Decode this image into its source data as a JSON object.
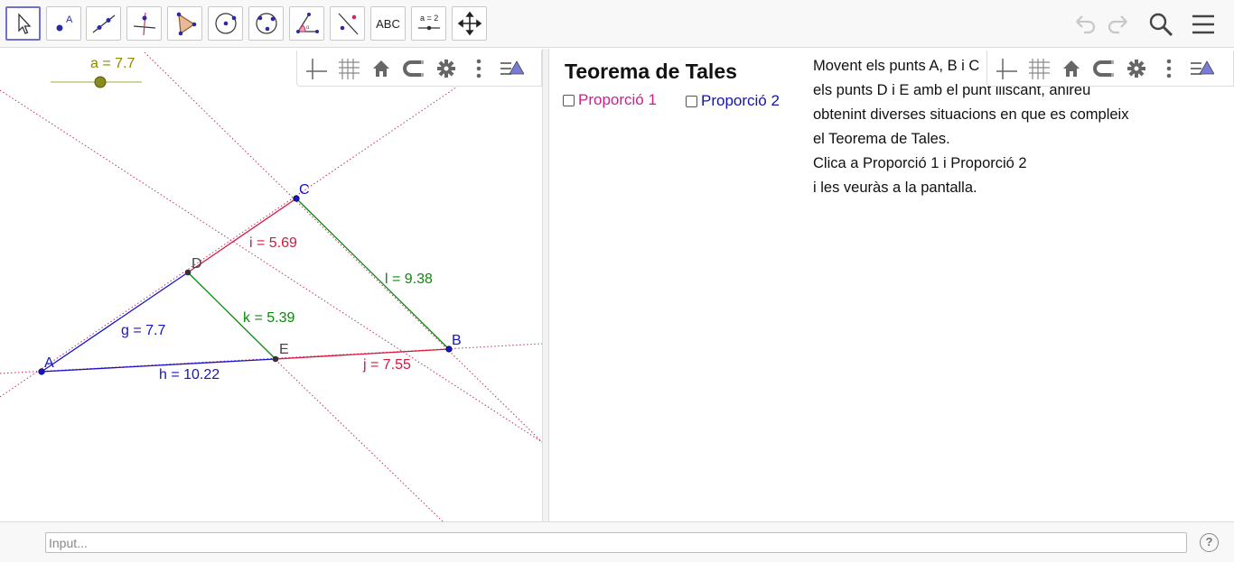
{
  "toolbar": {
    "tools": [
      {
        "name": "move-tool",
        "active": true
      },
      {
        "name": "point-tool"
      },
      {
        "name": "line-tool"
      },
      {
        "name": "perpendicular-line-tool"
      },
      {
        "name": "polygon-tool"
      },
      {
        "name": "circle-center-point-tool"
      },
      {
        "name": "circle-three-points-tool"
      },
      {
        "name": "angle-tool"
      },
      {
        "name": "reflect-about-line-tool"
      },
      {
        "name": "text-tool",
        "label": "ABC"
      },
      {
        "name": "slider-tool",
        "label": "a = 2"
      },
      {
        "name": "move-graphics-view-tool"
      }
    ],
    "right_icons": [
      "undo-icon",
      "redo-icon",
      "search-icon",
      "menu-icon"
    ]
  },
  "slider": {
    "label": "a = 7.7",
    "value": 7.7
  },
  "geometry": {
    "points": [
      {
        "name": "A",
        "color": "#1414cc"
      },
      {
        "name": "B",
        "color": "#1414cc"
      },
      {
        "name": "C",
        "color": "#1414cc"
      },
      {
        "name": "D",
        "color": "#333333"
      },
      {
        "name": "E",
        "color": "#333333"
      }
    ],
    "segments": [
      {
        "label": "g = 7.7",
        "color": "#1414cc"
      },
      {
        "label": "h = 10.22",
        "color": "#1414cc"
      },
      {
        "label": "i = 5.69",
        "color": "#d8163c"
      },
      {
        "label": "j = 7.55",
        "color": "#d8163c"
      },
      {
        "label": "k = 5.39",
        "color": "#0a8a0a"
      },
      {
        "label": "l = 9.38",
        "color": "#0a8a0a"
      }
    ],
    "auxiliary_line_color": "#c0306a"
  },
  "panel": {
    "title": "Teorema de Tales",
    "checkbox1": {
      "label": "Proporció 1",
      "color": "#cc1f8e",
      "checked": false
    },
    "checkbox2": {
      "label": "Proporció 2",
      "color": "#1414a8",
      "checked": false
    },
    "info_lines": [
      "Movent els punts A, B i C",
      "els punts D i E amb el punt lliscant, anireu",
      "obtenint diverses situacions en que es compleix",
      "el Teorema de Tales.",
      "Clica a Proporció 1 i Proporció 2",
      "i les veuràs a la pantalla."
    ]
  },
  "input": {
    "placeholder": "Input..."
  },
  "help": {
    "label": "?"
  }
}
